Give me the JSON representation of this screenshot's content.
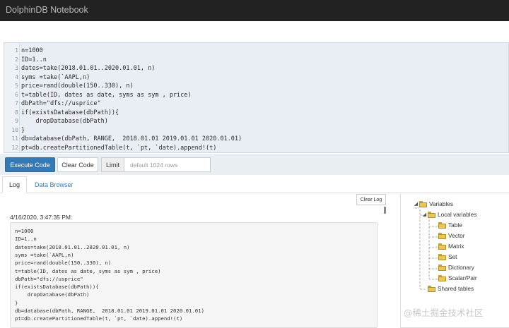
{
  "app": {
    "title": "DolphinDB Notebook"
  },
  "editor": {
    "lines": [
      {
        "no": "1",
        "text": "n=1000"
      },
      {
        "no": "2",
        "text": "ID=1..n"
      },
      {
        "no": "3",
        "text": "dates=take(2018.01.01..2020.01.01, n)"
      },
      {
        "no": "4",
        "text": "syms =take(`AAPL,n)"
      },
      {
        "no": "5",
        "text": "price=rand(double(150..330), n)"
      },
      {
        "no": "6",
        "text": "t=table(ID, dates as date, syms as sym , price)"
      },
      {
        "no": "7",
        "text": "dbPath=\"dfs://usprice\""
      },
      {
        "no": "8",
        "text": "if(existsDatabase(dbPath)){"
      },
      {
        "no": "9",
        "text": "    dropDatabase(dbPath)"
      },
      {
        "no": "10",
        "text": "}"
      },
      {
        "no": "11",
        "text": "db=database(dbPath, RANGE,  2018.01.01 2019.01.01 2020.01.01)"
      },
      {
        "no": "12",
        "text": "pt=db.createPartitionedTable(t, `pt, `date).append!(t)"
      }
    ]
  },
  "toolbar": {
    "execute_label": "Execute Code",
    "clear_label": "Clear Code",
    "limit_label": "Limit",
    "limit_placeholder": "default 1024 rows"
  },
  "tabs": {
    "log": "Log",
    "data_browser": "Data Browser"
  },
  "log": {
    "clear_label": "Clear Log",
    "timestamp": "4/16/2020, 3:47:35 PM:",
    "lines": [
      "n=1000",
      "ID=1..n",
      "dates=take(2018.01.01..2020.01.01, n)",
      "syms =take(`AAPL,n)",
      "price=rand(double(150..330), n)",
      "t=table(ID, dates as date, syms as sym , price)",
      "dbPath=\"dfs://usprice\"",
      "if(existsDatabase(dbPath)){",
      "    dropDatabase(dbPath)",
      "}",
      "db=database(dbPath, RANGE,  2018.01.01 2019.01.01 2020.01.01)",
      "pt=db.createPartitionedTable(t, `pt, `date).append!(t)"
    ]
  },
  "variables": {
    "root": "Variables",
    "local": "Local variables",
    "local_items": [
      "Table",
      "Vector",
      "Matrix",
      "Set",
      "Dictionary",
      "Scalar/Pair"
    ],
    "shared": "Shared tables"
  },
  "watermark": "@稀土掘金技术社区",
  "colors": {
    "navbar": "#222222",
    "primary": "#337ab7",
    "folder": "#e8c65a"
  }
}
